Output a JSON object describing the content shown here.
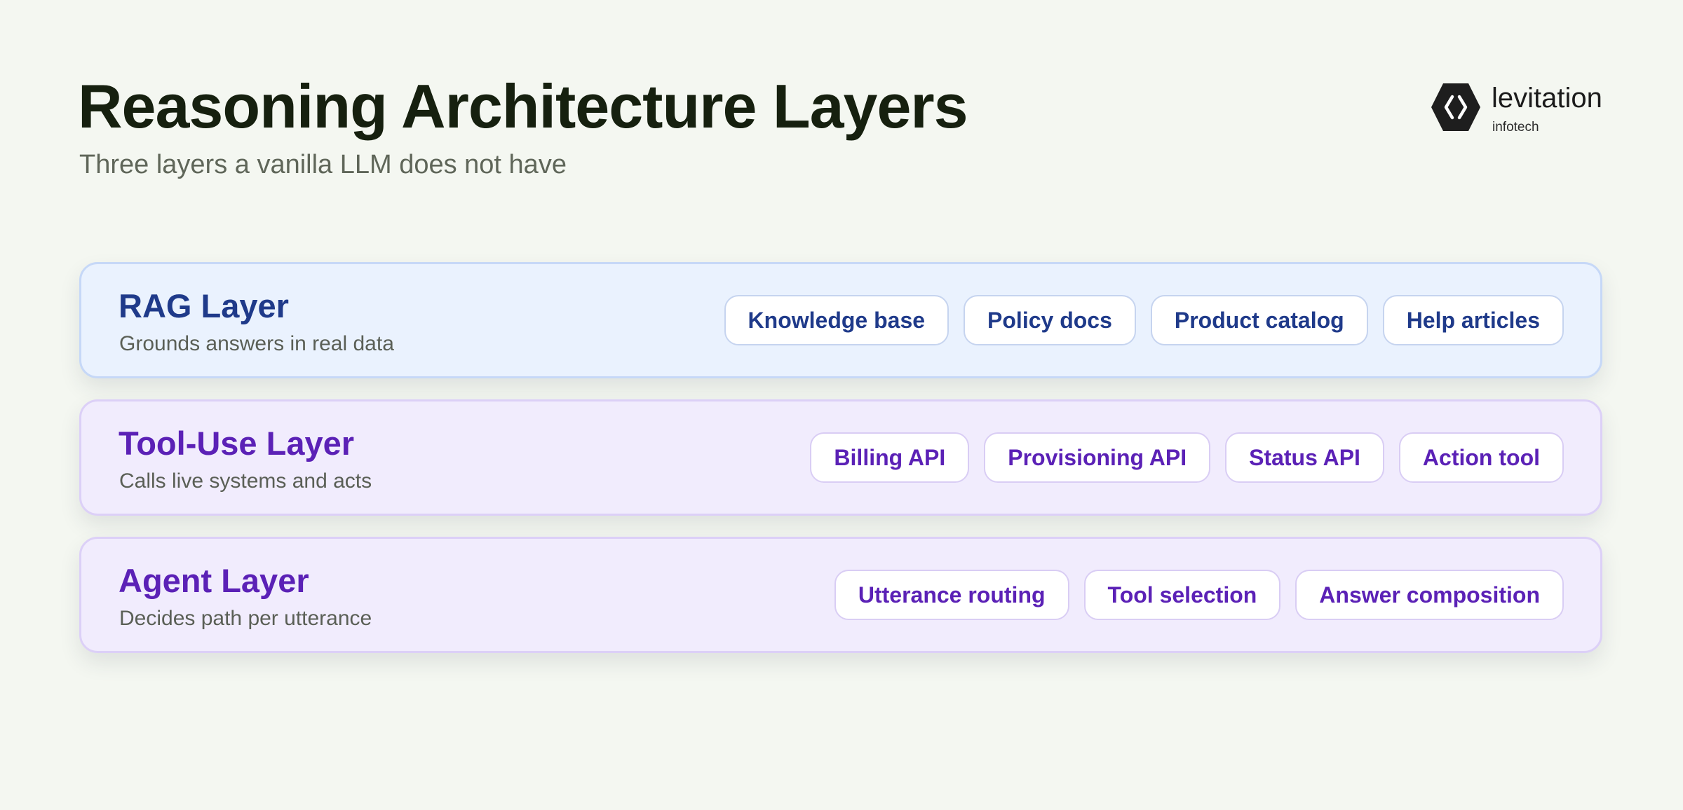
{
  "header": {
    "title": "Reasoning Architecture Layers",
    "subtitle": "Three layers a vanilla LLM does not have"
  },
  "logo": {
    "icon": "code-brackets-hexagon-icon",
    "name": "levitation",
    "tagline": "infotech"
  },
  "layers": [
    {
      "name": "RAG Layer",
      "description": "Grounds answers in real data",
      "color": "#1f3a8a",
      "background": "#eaf2fe",
      "items": [
        "Knowledge base",
        "Policy docs",
        "Product catalog",
        "Help articles"
      ]
    },
    {
      "name": "Tool-Use Layer",
      "description": "Calls live systems and acts",
      "color": "#5b21b6",
      "background": "#f1ecfd",
      "items": [
        "Billing API",
        "Provisioning API",
        "Status API",
        "Action tool"
      ]
    },
    {
      "name": "Agent Layer",
      "description": "Decides path per utterance",
      "color": "#5b21b6",
      "background": "#f1ecfd",
      "items": [
        "Utterance routing",
        "Tool selection",
        "Answer composition"
      ]
    }
  ]
}
